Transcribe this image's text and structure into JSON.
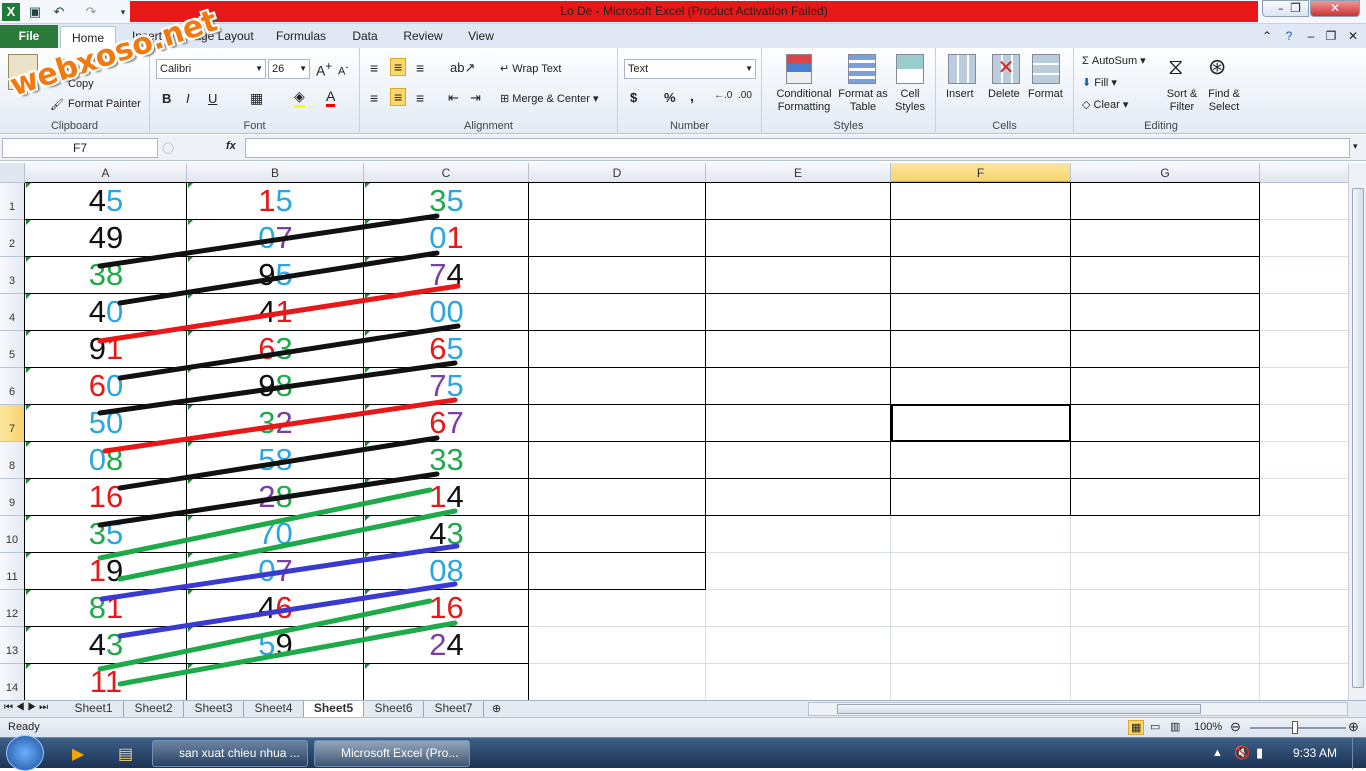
{
  "window": {
    "title": "Lo De  -  Microsoft Excel (Product Activation Failed)"
  },
  "ribbon_tabs": [
    "File",
    "Home",
    "Insert",
    "Page Layout",
    "Formulas",
    "Data",
    "Review",
    "View"
  ],
  "clipboard": {
    "copy": "Copy",
    "format_painter": "Format Painter",
    "label": "Clipboard"
  },
  "font": {
    "name": "Calibri",
    "size": "26",
    "label": "Font",
    "bold": "B",
    "italic": "I",
    "underline": "U"
  },
  "alignment": {
    "wrap": "Wrap Text",
    "merge": "Merge & Center",
    "label": "Alignment"
  },
  "number": {
    "format": "Text",
    "label": "Number",
    "dollar": "$",
    "percent": "%",
    "comma": ","
  },
  "styles": {
    "cond": "Conditional Formatting",
    "table": "Format as Table",
    "cell": "Cell Styles",
    "label": "Styles"
  },
  "cells": {
    "insert": "Insert",
    "delete": "Delete",
    "format": "Format",
    "label": "Cells"
  },
  "editing": {
    "autosum": "AutoSum",
    "fill": "Fill",
    "clear": "Clear",
    "sort": "Sort & Filter",
    "find": "Find & Select",
    "label": "Editing"
  },
  "formula_bar": {
    "name_box": "F7",
    "fx": "fx",
    "value": ""
  },
  "columns": [
    "A",
    "B",
    "C",
    "D",
    "E",
    "F",
    "G"
  ],
  "rows": [
    "1",
    "2",
    "3",
    "4",
    "5",
    "6",
    "7",
    "8",
    "9",
    "10",
    "11",
    "12",
    "13",
    "14"
  ],
  "cells_data": [
    [
      "45",
      "15",
      "35"
    ],
    [
      "49",
      "07",
      "01"
    ],
    [
      "38",
      "95",
      "74"
    ],
    [
      "40",
      "41",
      "00"
    ],
    [
      "91",
      "63",
      "65"
    ],
    [
      "60",
      "98",
      "75"
    ],
    [
      "50",
      "32",
      "67"
    ],
    [
      "08",
      "58",
      "33"
    ],
    [
      "16",
      "28",
      "14"
    ],
    [
      "35",
      "70",
      "43"
    ],
    [
      "19",
      "07",
      "08"
    ],
    [
      "81",
      "46",
      "16"
    ],
    [
      "43",
      "59",
      "24"
    ],
    [
      "11",
      "",
      ""
    ]
  ],
  "sheets": [
    "Sheet1",
    "Sheet2",
    "Sheet3",
    "Sheet4",
    "Sheet5",
    "Sheet6",
    "Sheet7"
  ],
  "active_sheet": "Sheet5",
  "status": {
    "ready": "Ready",
    "zoom": "100%"
  },
  "taskbar": {
    "item1": "san xuat chieu nhua ...",
    "item2": "Microsoft Excel (Pro...",
    "clock": "9:33 AM"
  },
  "watermark": "webxoso.net",
  "colors": {
    "red": "#e81818",
    "black": "#111111",
    "blue": "#2aa6e0",
    "green": "#1faa4a",
    "purple": "#7b3fa0",
    "line_blue": "#3a3ad0"
  }
}
